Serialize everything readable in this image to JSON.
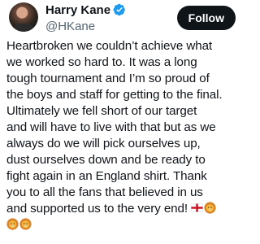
{
  "tweet": {
    "author": {
      "display_name": "Harry Kane",
      "handle": "@HKane",
      "verified": true,
      "avatar_icon": "profile-photo"
    },
    "follow_label": "Follow",
    "text_lines": [
      "Heartbroken we couldn’t achieve what",
      "we worked so hard to. It was a long",
      "tough tournament and I’m so proud of",
      "the boys and staff for getting to the final.",
      "Ultimately we fell short of our target",
      "and will have to live with that but as we",
      "always do we will pick ourselves up,",
      "dust ourselves down and be ready to",
      "fight again in an England shirt. Thank",
      "you to all the fans that believed in us",
      "and supported us to the very end!",
      ""
    ],
    "emojis": {
      "line_11": [
        "england-flag-icon",
        "lion-face-icon"
      ],
      "line_12": [
        "lion-face-icon",
        "lion-face-icon"
      ]
    },
    "colors": {
      "verified_badge": "#1d9bf0",
      "follow_button_bg": "#0f1419",
      "follow_button_text": "#ffffff",
      "handle_text": "#536471",
      "body_text": "#0f1419"
    }
  }
}
